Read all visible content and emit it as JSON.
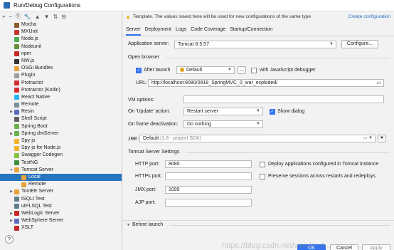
{
  "window": {
    "title": "Run/Debug Configurations"
  },
  "left_toolbar": [
    "+",
    "−",
    "⎘",
    "🔧",
    "▲",
    "▼",
    "⇅",
    "⊟"
  ],
  "tree": [
    {
      "label": "Mocha",
      "color": "#8b5a2b",
      "arrow": "",
      "depth": 0
    },
    {
      "label": "MXUnit",
      "color": "#c0392b",
      "arrow": "",
      "depth": 0
    },
    {
      "label": "Node.js",
      "color": "#4caf50",
      "arrow": "",
      "depth": 0
    },
    {
      "label": "Nodeunit",
      "color": "#6d8f3c",
      "arrow": "",
      "depth": 0
    },
    {
      "label": "npm",
      "color": "#c62828",
      "arrow": "",
      "depth": 0
    },
    {
      "label": "NW.js",
      "color": "#333333",
      "arrow": "",
      "depth": 0
    },
    {
      "label": "OSGi Bundles",
      "color": "#e6a23c",
      "arrow": "",
      "depth": 0
    },
    {
      "label": "Plugin",
      "color": "#9e9e9e",
      "arrow": "",
      "depth": 0
    },
    {
      "label": "Protractor",
      "color": "#d32f2f",
      "arrow": "",
      "depth": 0
    },
    {
      "label": "Protractor (Kotlin)",
      "color": "#d32f2f",
      "arrow": "",
      "depth": 0
    },
    {
      "label": "React Native",
      "color": "#29b6f6",
      "arrow": "",
      "depth": 0
    },
    {
      "label": "Remote",
      "color": "#78909c",
      "arrow": "",
      "depth": 0
    },
    {
      "label": "Resin",
      "color": "#5c6bc0",
      "arrow": "▶",
      "depth": 0
    },
    {
      "label": "Shell Script",
      "color": "#616161",
      "arrow": "",
      "depth": 0
    },
    {
      "label": "Spring Boot",
      "color": "#6ab04c",
      "arrow": "",
      "depth": 0
    },
    {
      "label": "Spring dmServer",
      "color": "#6ab04c",
      "arrow": "▶",
      "depth": 0
    },
    {
      "label": "Spy-js",
      "color": "#f0b429",
      "arrow": "",
      "depth": 0
    },
    {
      "label": "Spy-js for Node.js",
      "color": "#f0b429",
      "arrow": "",
      "depth": 0
    },
    {
      "label": "Swagger Codegen",
      "color": "#85c441",
      "arrow": "",
      "depth": 0
    },
    {
      "label": "TestNG",
      "color": "#3f8f3f",
      "arrow": "",
      "depth": 0
    },
    {
      "label": "Tomcat Server",
      "color": "#e8a33d",
      "arrow": "▼",
      "depth": 0
    },
    {
      "label": "Local",
      "color": "#e8a33d",
      "arrow": "",
      "depth": 1
    },
    {
      "label": "Remote",
      "color": "#e8a33d",
      "arrow": "",
      "depth": 1
    },
    {
      "label": "TomEE Server",
      "color": "#e8a33d",
      "arrow": "▶",
      "depth": 0
    },
    {
      "label": "tSQLt Test",
      "color": "#607d8b",
      "arrow": "",
      "depth": 0
    },
    {
      "label": "utPLSQL Test",
      "color": "#607d8b",
      "arrow": "",
      "depth": 0
    },
    {
      "label": "WebLogic Server",
      "color": "#c62828",
      "arrow": "▶",
      "depth": 0
    },
    {
      "label": "WebSphere Server",
      "color": "#5c6bc0",
      "arrow": "▶",
      "depth": 0
    },
    {
      "label": "XSLT",
      "color": "#c62828",
      "arrow": "",
      "depth": 0
    }
  ],
  "selected_index": 21,
  "warning": {
    "text": "Template. The values saved here will be used for new configurations of the same type",
    "link": "Create configuration"
  },
  "tabs": [
    "Server",
    "Deployment",
    "Logs",
    "Code Coverage",
    "Startup/Connection"
  ],
  "active_tab": 0,
  "form": {
    "app_server_label": "Application server:",
    "app_server_value": "Tomcat 8.5.57",
    "configure_label": "Configure...",
    "open_browser_label": "Open browser",
    "after_launch_label": "After launch",
    "browser_value": "Default",
    "ellipsis_label": "...",
    "js_debugger_label": "with JavaScript debugger",
    "url_label": "URL:",
    "url_value": "http://localhost:8080/0918_SpringMVC_0_war_exploded/",
    "vm_options_label": "VM options:",
    "vm_options_value": "",
    "on_update_label": "On 'Update' action:",
    "on_update_value": "Restart server",
    "show_dialog_label": "Show dialog",
    "on_frame_label": "On frame deactivation:",
    "on_frame_value": "Do nothing",
    "jre_label": "JRE:",
    "jre_value": "Default",
    "jre_hint": "(1.8 - project SDK)",
    "tomcat_settings_label": "Tomcat Server Settings",
    "http_port_label": "HTTP port:",
    "http_port_value": "8080",
    "https_port_label": "HTTPs port:",
    "https_port_value": "",
    "jmx_port_label": "JMX port:",
    "jmx_port_value": "1099",
    "ajp_port_label": "AJP port:",
    "ajp_port_value": "",
    "deploy_label": "Deploy applications configured in Tomcat instance",
    "preserve_label": "Preserve sessions across restarts and redeploys",
    "before_launch_label": "Before launch"
  },
  "footer": {
    "help": "?",
    "ok": "OK",
    "cancel": "Cancel",
    "apply": "Apply"
  },
  "watermark": "https://blog.csdn.net/weixin_4..."
}
